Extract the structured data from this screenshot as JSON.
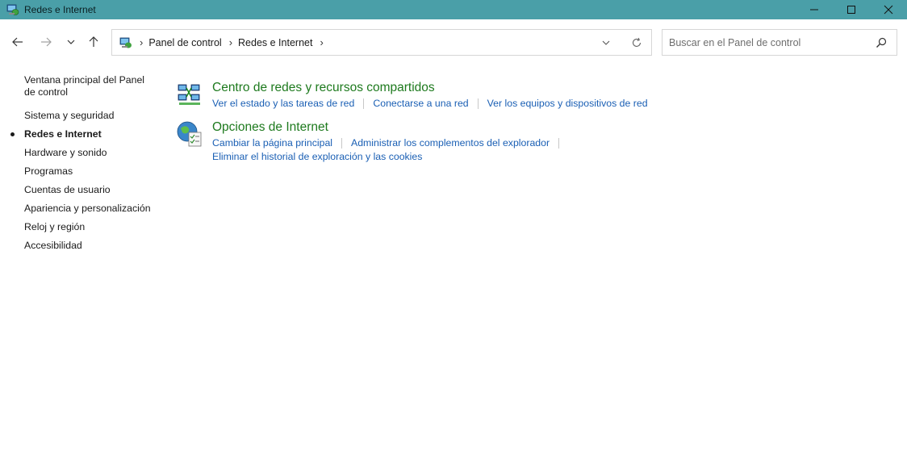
{
  "window": {
    "title": "Redes e Internet"
  },
  "address": {
    "crumbs": [
      "Panel de control",
      "Redes e Internet"
    ]
  },
  "search": {
    "placeholder": "Buscar en el Panel de control"
  },
  "sidebar": {
    "items": [
      {
        "label": "Ventana principal del Panel de control",
        "active": false
      },
      {
        "label": "Sistema y seguridad",
        "active": false
      },
      {
        "label": "Redes e Internet",
        "active": true
      },
      {
        "label": "Hardware y sonido",
        "active": false
      },
      {
        "label": "Programas",
        "active": false
      },
      {
        "label": "Cuentas de usuario",
        "active": false
      },
      {
        "label": "Apariencia y personalización",
        "active": false
      },
      {
        "label": "Reloj y región",
        "active": false
      },
      {
        "label": "Accesibilidad",
        "active": false
      }
    ]
  },
  "categories": [
    {
      "title": "Centro de redes y recursos compartidos",
      "links": [
        "Ver el estado y las tareas de red",
        "Conectarse a una red",
        "Ver los equipos y dispositivos de red"
      ]
    },
    {
      "title": "Opciones de Internet",
      "links": [
        "Cambiar la página principal",
        "Administrar los complementos del explorador",
        "Eliminar el historial de exploración y las cookies"
      ]
    }
  ],
  "colors": {
    "titlebar": "#4a9fa8",
    "category_title": "#1e7a1e",
    "link": "#1a5fb4"
  }
}
